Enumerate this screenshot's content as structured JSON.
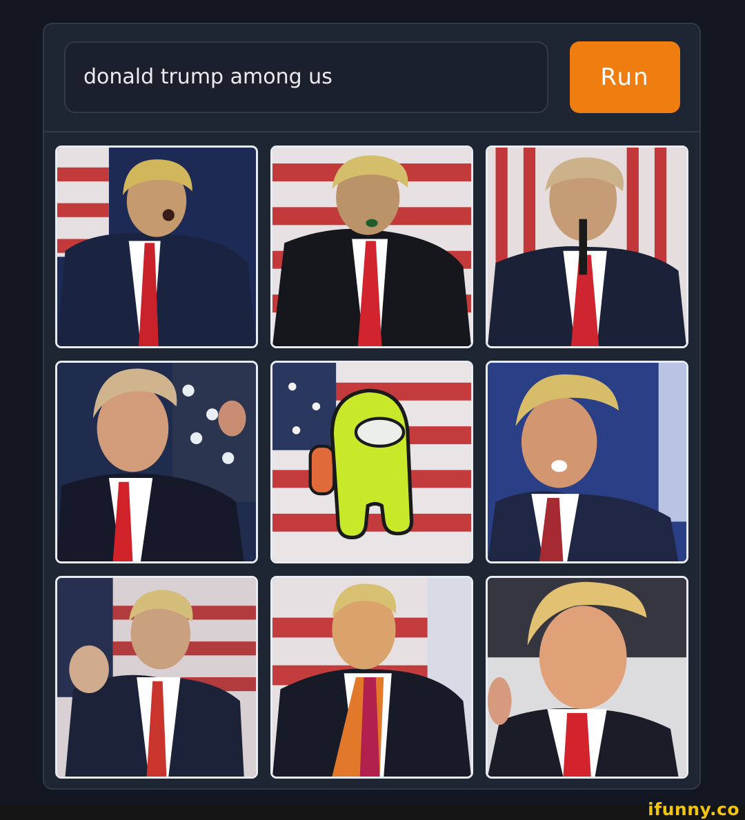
{
  "prompt": {
    "value": "donald trump among us"
  },
  "run_button": {
    "label": "Run"
  },
  "results": [
    {
      "name": "result-image-1",
      "kind": "man-in-suit"
    },
    {
      "name": "result-image-2",
      "kind": "man-in-suit"
    },
    {
      "name": "result-image-3",
      "kind": "man-in-suit"
    },
    {
      "name": "result-image-4",
      "kind": "man-in-suit"
    },
    {
      "name": "result-image-5",
      "kind": "among-us-crewmate"
    },
    {
      "name": "result-image-6",
      "kind": "man-in-suit"
    },
    {
      "name": "result-image-7",
      "kind": "man-in-suit"
    },
    {
      "name": "result-image-8",
      "kind": "man-in-suit"
    },
    {
      "name": "result-image-9",
      "kind": "man-in-suit"
    }
  ],
  "watermark": {
    "text": "ifunny.co"
  },
  "colors": {
    "background": "#121722",
    "panel": "#1f2633",
    "accent": "#f07d10",
    "watermark": "#f4c60a"
  }
}
